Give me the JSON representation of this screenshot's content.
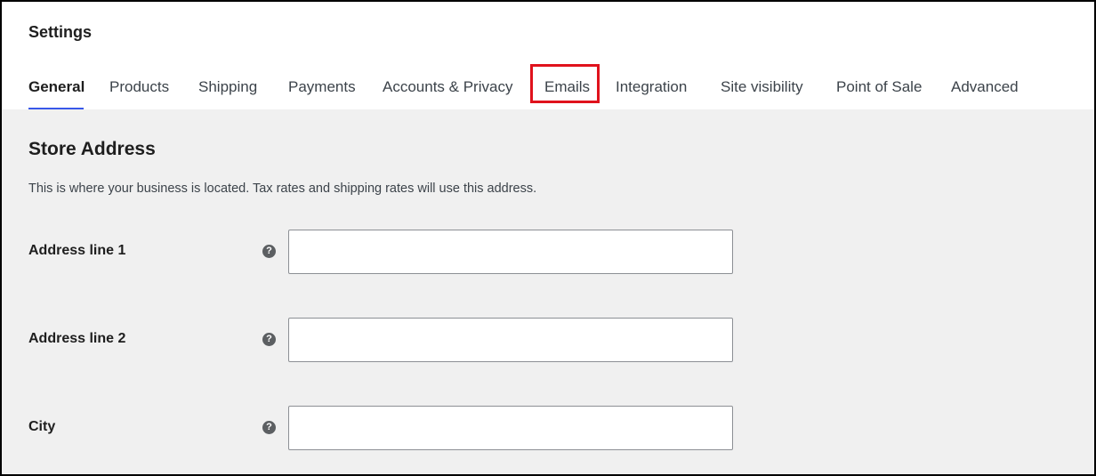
{
  "header": {
    "title": "Settings",
    "tabs": [
      {
        "label": "General",
        "active": true
      },
      {
        "label": "Products",
        "active": false
      },
      {
        "label": "Shipping",
        "active": false
      },
      {
        "label": "Payments",
        "active": false
      },
      {
        "label": "Accounts & Privacy",
        "active": false
      },
      {
        "label": "Emails",
        "active": false,
        "highlighted": true
      },
      {
        "label": "Integration",
        "active": false
      },
      {
        "label": "Site visibility",
        "active": false
      },
      {
        "label": "Point of Sale",
        "active": false
      },
      {
        "label": "Advanced",
        "active": false
      }
    ]
  },
  "section": {
    "title": "Store Address",
    "description": "This is where your business is located. Tax rates and shipping rates will use this address."
  },
  "fields": [
    {
      "label": "Address line 1",
      "value": ""
    },
    {
      "label": "Address line 2",
      "value": ""
    },
    {
      "label": "City",
      "value": ""
    }
  ],
  "colors": {
    "active_tab_underline": "#3858e9",
    "highlight_box": "#e0121c",
    "content_background": "#f0f0f0"
  }
}
